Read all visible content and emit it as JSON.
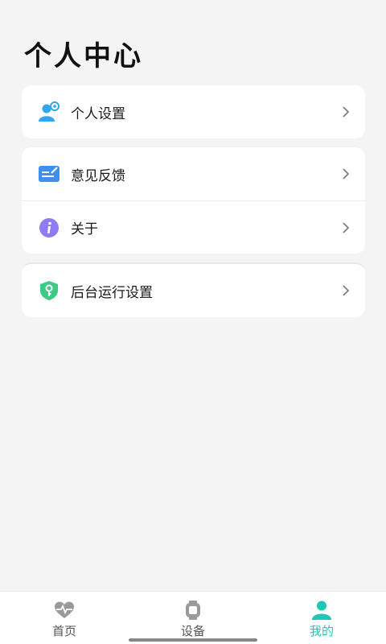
{
  "header": {
    "title": "个人中心"
  },
  "menu": {
    "personal_settings": {
      "label": "个人设置",
      "icon": "user-settings-icon",
      "color": "#2fa7f0"
    },
    "feedback": {
      "label": "意见反馈",
      "icon": "feedback-icon",
      "color": "#3d8ff0"
    },
    "about": {
      "label": "关于",
      "icon": "info-icon",
      "color": "#8e7cf2"
    },
    "background_settings": {
      "label": "后台运行设置",
      "icon": "shield-key-icon",
      "color": "#3ec984"
    }
  },
  "tabbar": {
    "items": [
      {
        "label": "首页",
        "icon": "heart-pulse-icon",
        "active": false
      },
      {
        "label": "设备",
        "icon": "watch-icon",
        "active": false
      },
      {
        "label": "我的",
        "icon": "person-icon",
        "active": true
      }
    ],
    "active_color": "#1fc7b4",
    "inactive_color": "#9a9a9a"
  }
}
